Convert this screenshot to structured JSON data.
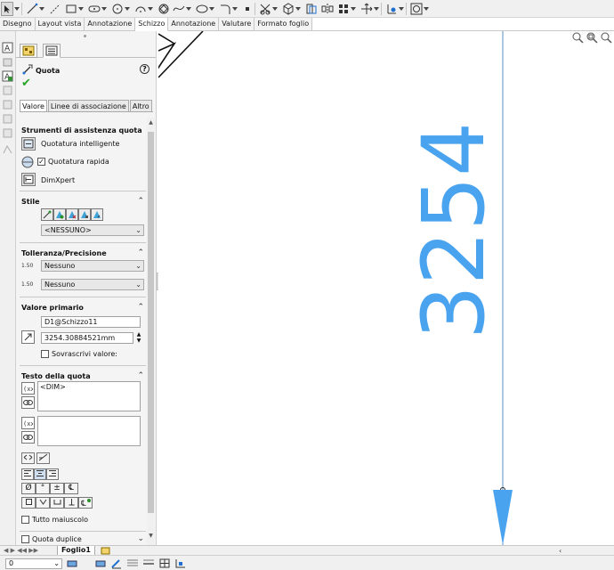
{
  "tabs": [
    "Disegno",
    "Layout vista",
    "Annotazione",
    "Schizzo",
    "Annotazione",
    "Valutare",
    "Formato foglio"
  ],
  "active_tab": "Schizzo",
  "property_manager": {
    "title": "Quota",
    "help": "?",
    "sub_tabs": [
      "Valore",
      "Linee di associazione",
      "Altro"
    ],
    "groups": {
      "strumenti": {
        "header": "Strumenti di assistenza quota",
        "quotatura_intelligente": "Quotatura intelligente",
        "quotatura_rapida": "Quotatura rapida",
        "dimxpert": "DimXpert"
      },
      "stile": {
        "header": "Stile",
        "select_value": "<NESSUNO>"
      },
      "tolleranza": {
        "header": "Tolleranza/Precisione",
        "tolerance_value": "Nessuno",
        "precision_value": "Nessuno",
        "tolerance_icon_text": "1.50",
        "precision_icon_text": "1.50"
      },
      "valore_primario": {
        "header": "Valore primario",
        "name": "D1@Schizzo11",
        "value": "3254.30884521mm",
        "override_label": "Sovrascrivi valore:"
      },
      "testo": {
        "header": "Testo della quota",
        "text": "<DIM>"
      },
      "symbols": [
        "Ø",
        "°",
        "±",
        "℄"
      ],
      "all_caps_label": "Tutto maiuscolo",
      "dual_label": "Quota duplice"
    }
  },
  "canvas": {
    "dimension_text": "3254"
  },
  "sheet_tab": "Foglio1",
  "status": {
    "zoom_value": "0"
  },
  "colors": {
    "dimension": "#4aa3ef",
    "accent_check": "#27a527"
  }
}
